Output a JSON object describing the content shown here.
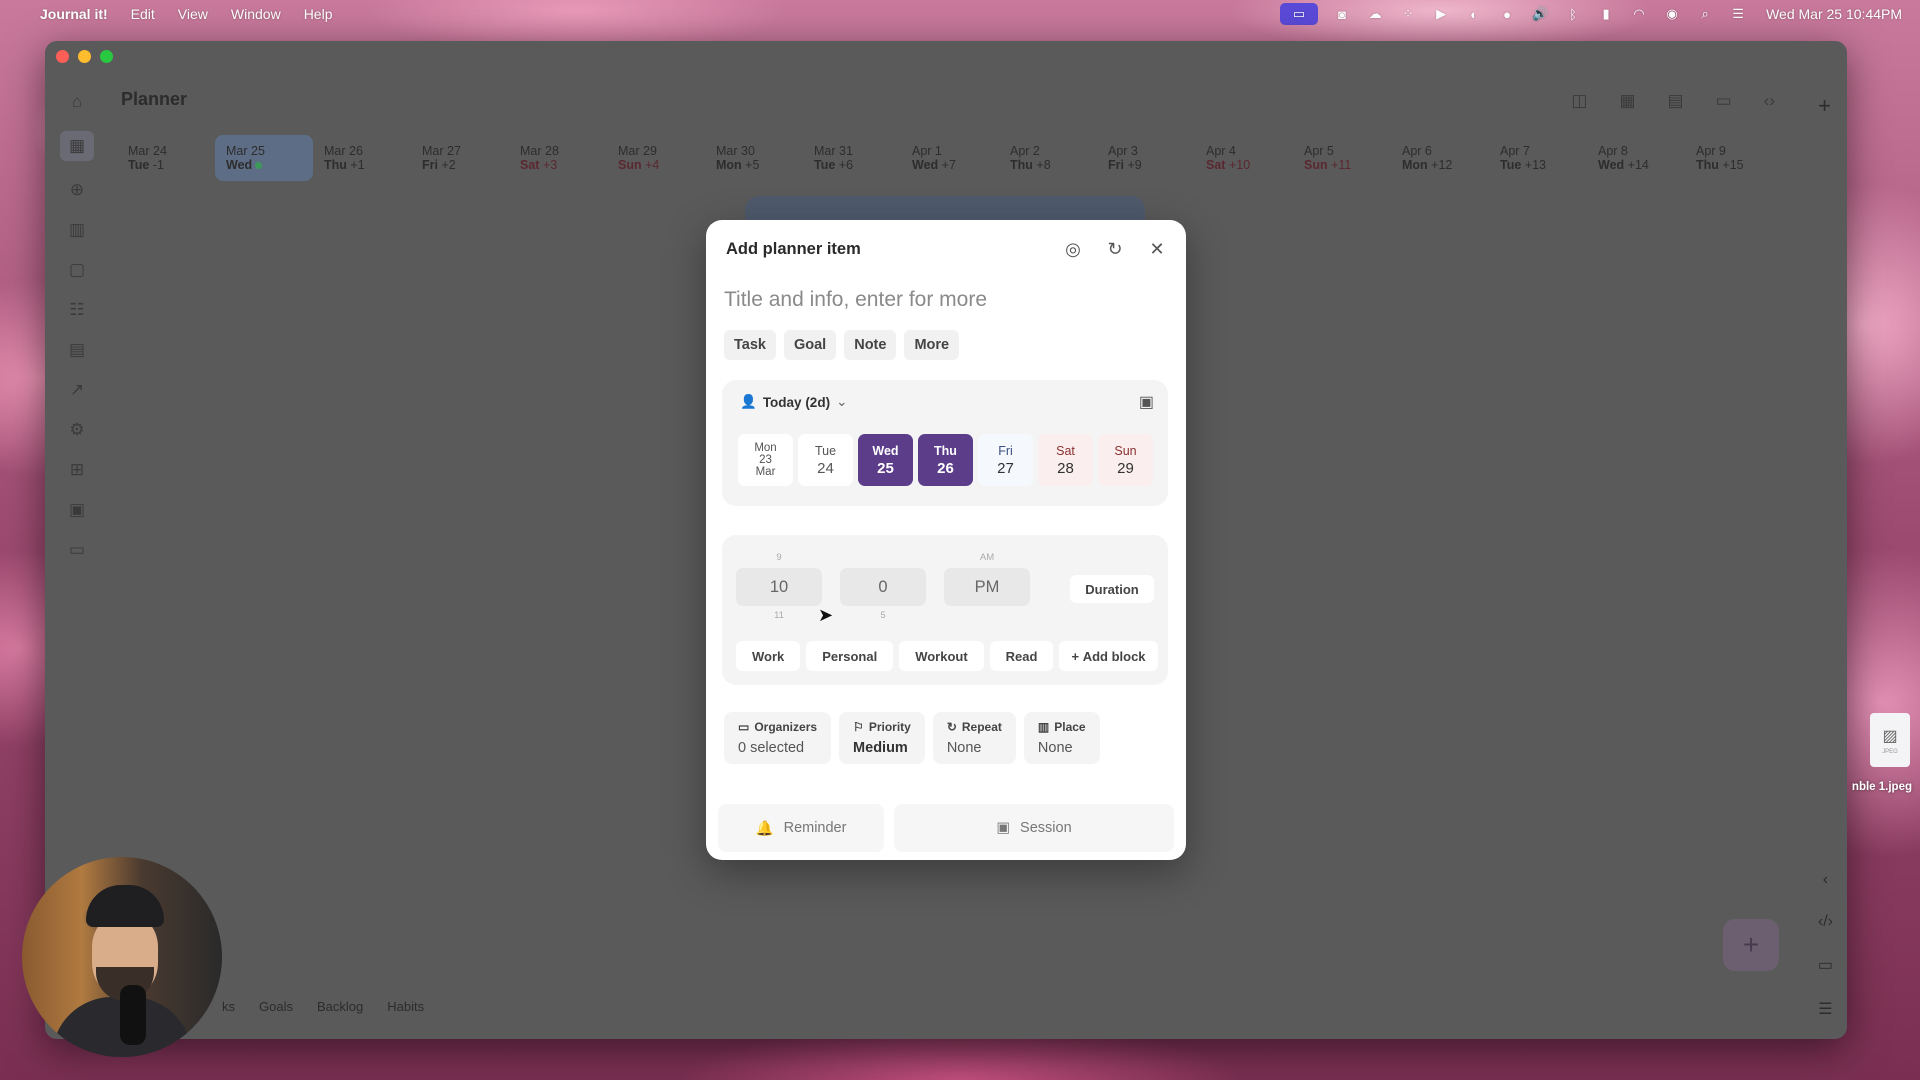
{
  "menubar": {
    "app_name": "Journal it!",
    "menus": [
      "Edit",
      "View",
      "Window",
      "Help"
    ],
    "clock": "Wed Mar 25  10:44PM"
  },
  "window": {
    "title": "Planner",
    "dates": [
      {
        "d1": "Mar 24",
        "dow": "Tue",
        "rel": "-1"
      },
      {
        "d1": "Mar 25",
        "dow": "Wed",
        "rel": ""
      },
      {
        "d1": "Mar 26",
        "dow": "Thu",
        "rel": "+1"
      },
      {
        "d1": "Mar 27",
        "dow": "Fri",
        "rel": "+2"
      },
      {
        "d1": "Mar 28",
        "dow": "Sat",
        "rel": "+3"
      },
      {
        "d1": "Mar 29",
        "dow": "Sun",
        "rel": "+4"
      },
      {
        "d1": "Mar 30",
        "dow": "Mon",
        "rel": "+5"
      },
      {
        "d1": "Mar 31",
        "dow": "Tue",
        "rel": "+6"
      },
      {
        "d1": "Apr 1",
        "dow": "Wed",
        "rel": "+7"
      },
      {
        "d1": "Apr 2",
        "dow": "Thu",
        "rel": "+8"
      },
      {
        "d1": "Apr 3",
        "dow": "Fri",
        "rel": "+9"
      },
      {
        "d1": "Apr 4",
        "dow": "Sat",
        "rel": "+10"
      },
      {
        "d1": "Apr 5",
        "dow": "Sun",
        "rel": "+11"
      },
      {
        "d1": "Apr 6",
        "dow": "Mon",
        "rel": "+12"
      },
      {
        "d1": "Apr 7",
        "dow": "Tue",
        "rel": "+13"
      },
      {
        "d1": "Apr 8",
        "dow": "Wed",
        "rel": "+14"
      },
      {
        "d1": "Apr 9",
        "dow": "Thu",
        "rel": "+15"
      }
    ],
    "bottom_tabs": [
      "ks",
      "Goals",
      "Backlog",
      "Habits"
    ],
    "fab_label": "+",
    "top_plus": "+"
  },
  "desktop": {
    "file_label": "nble 1.jpeg",
    "file_type": "JPEG"
  },
  "modal": {
    "header": "Add planner item",
    "title_placeholder": "Title and info, enter for more",
    "types": [
      "Task",
      "Goal",
      "Note",
      "More"
    ],
    "date_selector": "Today (2d)",
    "days": [
      {
        "l1": "Mon",
        "l2": "23",
        "l3": "Mar"
      },
      {
        "dow": "Tue",
        "num": "24"
      },
      {
        "dow": "Wed",
        "num": "25"
      },
      {
        "dow": "Thu",
        "num": "26"
      },
      {
        "dow": "Fri",
        "num": "27"
      },
      {
        "dow": "Sat",
        "num": "28"
      },
      {
        "dow": "Sun",
        "num": "29"
      }
    ],
    "time": {
      "hour_prev": "9",
      "hour": "10",
      "hour_next": "11",
      "minute": "0",
      "minute_next": "5",
      "ampm_prev": "AM",
      "ampm": "PM"
    },
    "duration_label": "Duration",
    "blocks": [
      "Work",
      "Personal",
      "Workout",
      "Read"
    ],
    "add_block_label": "Add block",
    "props": {
      "organizers": {
        "label": "Organizers",
        "value": "0 selected"
      },
      "priority": {
        "label": "Priority",
        "value": "Medium"
      },
      "repeat": {
        "label": "Repeat",
        "value": "None"
      },
      "place": {
        "label": "Place",
        "value": "None"
      }
    },
    "reminder_label": "Reminder",
    "session_label": "Session"
  }
}
